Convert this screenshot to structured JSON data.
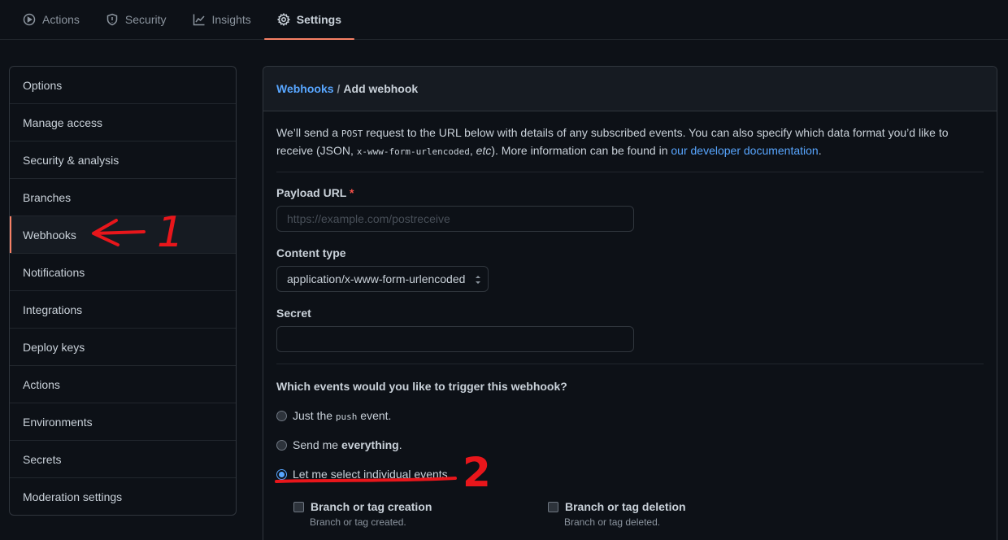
{
  "topnav": {
    "tabs": [
      {
        "label": "Actions",
        "icon": "play-circle-icon"
      },
      {
        "label": "Security",
        "icon": "shield-icon"
      },
      {
        "label": "Insights",
        "icon": "graph-icon"
      },
      {
        "label": "Settings",
        "icon": "gear-icon",
        "active": true
      }
    ]
  },
  "sidebar": {
    "items": [
      {
        "label": "Options"
      },
      {
        "label": "Manage access"
      },
      {
        "label": "Security & analysis"
      },
      {
        "label": "Branches"
      },
      {
        "label": "Webhooks",
        "active": true
      },
      {
        "label": "Notifications"
      },
      {
        "label": "Integrations"
      },
      {
        "label": "Deploy keys"
      },
      {
        "label": "Actions"
      },
      {
        "label": "Environments"
      },
      {
        "label": "Secrets"
      },
      {
        "label": "Moderation settings"
      }
    ]
  },
  "panel": {
    "breadcrumb": {
      "parent": "Webhooks",
      "sep": "/",
      "current": "Add webhook"
    },
    "intro": {
      "part1": "We’ll send a ",
      "code1": "POST",
      "part2": " request to the URL below with details of any subscribed events. You can also specify which data format you’d like to receive (JSON, ",
      "code2": "x-www-form-urlencoded",
      "part3": ", ",
      "etc": "etc",
      "part4": "). More information can be found in ",
      "link": "our developer documentation",
      "part5": "."
    },
    "payload_url": {
      "label": "Payload URL",
      "required": "*",
      "placeholder": "https://example.com/postreceive",
      "value": ""
    },
    "content_type": {
      "label": "Content type",
      "value": "application/x-www-form-urlencoded"
    },
    "secret": {
      "label": "Secret",
      "value": ""
    },
    "events": {
      "question": "Which events would you like to trigger this webhook?",
      "opt1": {
        "pre": "Just the ",
        "code": "push",
        "post": " event."
      },
      "opt2": {
        "pre": "Send me ",
        "bold": "everything",
        "post": "."
      },
      "opt3": {
        "label": "Let me select individual events."
      },
      "checkboxes": [
        {
          "label": "Branch or tag creation",
          "desc": "Branch or tag created."
        },
        {
          "label": "Branch or tag deletion",
          "desc": "Branch or tag deleted."
        }
      ]
    }
  },
  "annotations": {
    "marker1": "1",
    "marker2": "2",
    "color": "#e8161b"
  }
}
